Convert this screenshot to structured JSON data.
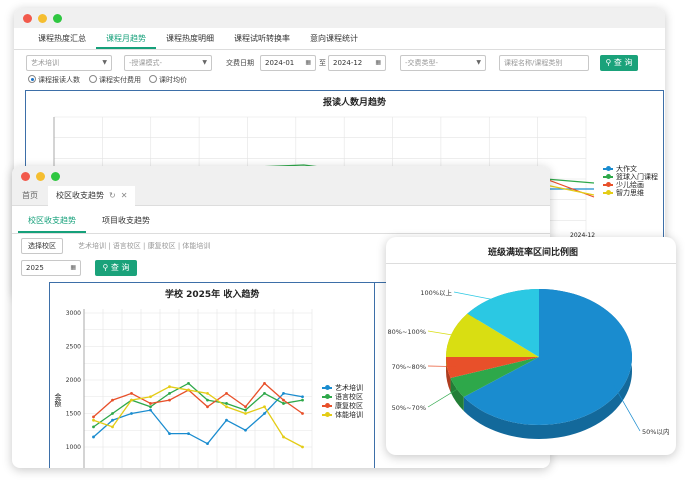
{
  "back_window": {
    "tabs": [
      "课程热度汇总",
      "课程月趋势",
      "课程热度明细",
      "课程试听转换率",
      "意向课程统计"
    ],
    "active_tab": 1,
    "filters": {
      "category": "艺术培训",
      "mode": "-授课模式-",
      "date_label": "交费日期",
      "date_from": "2024-01",
      "date_sep": "至",
      "date_to": "2024-12",
      "fee_type": "-交费类型-",
      "course_placeholder": "课程名称/课程类别",
      "query": "查 询"
    },
    "radios": [
      "课程报读人数",
      "课程实付费用",
      "课时均价"
    ],
    "chart_data": {
      "type": "line",
      "title": "报读人数月趋势",
      "x_last_label": "2024-12",
      "series": [
        {
          "name": "大作文",
          "color": "#1a8ccf"
        },
        {
          "name": "篮球入门课程",
          "color": "#2ea84a"
        },
        {
          "name": "少儿绘画",
          "color": "#e8502a"
        },
        {
          "name": "智力思维",
          "color": "#e4cc16"
        }
      ]
    }
  },
  "front_window": {
    "tabs": [
      "首页",
      "校区收支趋势"
    ],
    "refresh_icon": "refresh-icon",
    "close_icon": "close-icon",
    "subtabs": [
      "校区收支趋势",
      "项目收支趋势"
    ],
    "choose_school": "选择校区",
    "school_list": "艺术培训 | 语言校区 | 康复校区 | 体能培训",
    "year": "2025",
    "query": "查 询",
    "chart_data": {
      "type": "line",
      "title": "学校 2025年 收入趋势",
      "ylabel": "金额",
      "ylim": [
        1000,
        3000
      ],
      "yticks": [
        1000,
        1500,
        2000,
        2500,
        3000
      ],
      "series": [
        {
          "name": "艺术培训",
          "color": "#1a8ccf",
          "values": [
            1150,
            1400,
            1500,
            1550,
            1200,
            1200,
            1050,
            1400,
            1250,
            1500,
            1800,
            1750
          ]
        },
        {
          "name": "语言校区",
          "color": "#2ea84a",
          "values": [
            1300,
            1500,
            1700,
            1600,
            1800,
            1950,
            1700,
            1650,
            1550,
            1800,
            1650,
            1700
          ]
        },
        {
          "name": "康复校区",
          "color": "#e8502a",
          "values": [
            1450,
            1700,
            1800,
            1650,
            1700,
            1850,
            1600,
            1800,
            1600,
            1950,
            1700,
            1500
          ]
        },
        {
          "name": "体能培训",
          "color": "#e4cc16",
          "values": [
            1400,
            1300,
            1700,
            1750,
            1900,
            1850,
            1800,
            1600,
            1500,
            1600,
            1150,
            1000
          ]
        }
      ]
    }
  },
  "pie_card": {
    "chart_data": {
      "type": "pie",
      "title": "班级满班率区间比例图",
      "slices": [
        {
          "label": "50%以内",
          "value": 65,
          "color": "#1a8ccf"
        },
        {
          "label": "50%~70%",
          "value": 5,
          "color": "#2ea84a"
        },
        {
          "label": "70%~80%",
          "value": 5,
          "color": "#e8502a"
        },
        {
          "label": "80%~100%",
          "value": 11,
          "color": "#d9de12"
        },
        {
          "label": "100%以上",
          "value": 14,
          "color": "#2bc8e3"
        }
      ]
    }
  }
}
